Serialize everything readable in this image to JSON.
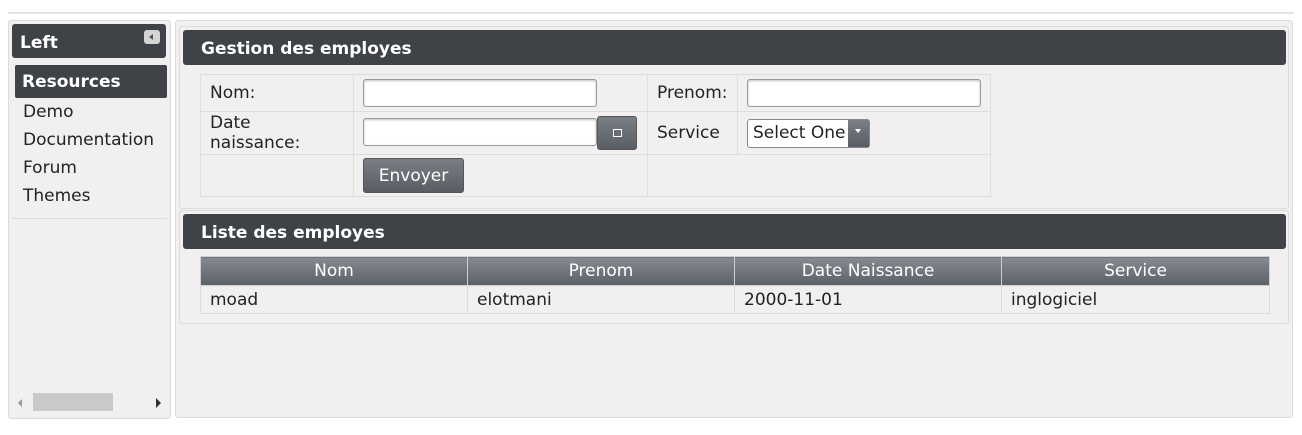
{
  "left": {
    "title": "Left",
    "menu_header": "Resources",
    "items": [
      "Demo",
      "Documentation",
      "Forum",
      "Themes"
    ]
  },
  "form_panel": {
    "title": "Gestion des employes",
    "nom_label": "Nom:",
    "nom_value": "",
    "prenom_label": "Prenom:",
    "prenom_value": "",
    "date_label": "Date naissance:",
    "date_value": "",
    "service_label": "Service",
    "service_selected": "Select One",
    "submit_label": "Envoyer"
  },
  "list_panel": {
    "title": "Liste des employes",
    "columns": [
      "Nom",
      "Prenom",
      "Date Naissance",
      "Service"
    ],
    "rows": [
      [
        "moad",
        "elotmani",
        "2000-11-01",
        "inglogiciel"
      ]
    ]
  },
  "colors": {
    "header_dark": "#3f4246",
    "panel_bg": "#f1efef",
    "button": "#6b7076"
  },
  "icons": {
    "collapse": "chevron-left-icon",
    "calendar": "calendar-icon",
    "dropdown": "chevron-down-icon"
  }
}
